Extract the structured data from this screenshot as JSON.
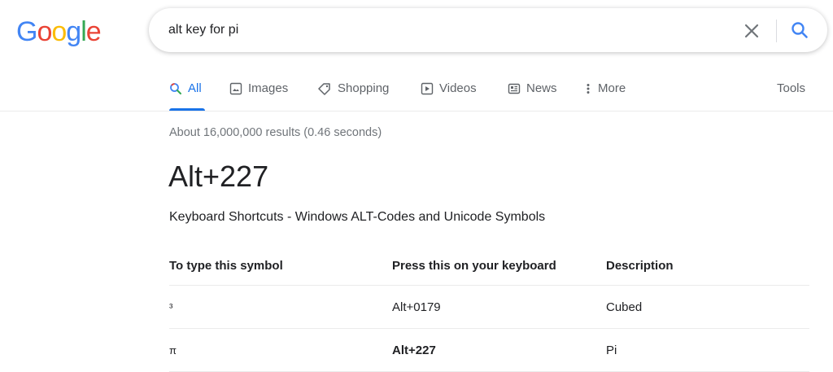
{
  "logo": {
    "letters": [
      "G",
      "o",
      "o",
      "g",
      "l",
      "e"
    ],
    "colors": [
      "#4285F4",
      "#EA4335",
      "#FBBC05",
      "#4285F4",
      "#34A853",
      "#EA4335"
    ]
  },
  "search": {
    "query": "alt key for pi",
    "clear_icon": "close-icon",
    "search_icon": "search-icon"
  },
  "tabs": [
    {
      "label": "All",
      "icon": "search-icon",
      "active": true
    },
    {
      "label": "Images",
      "icon": "image-icon"
    },
    {
      "label": "Shopping",
      "icon": "tag-icon"
    },
    {
      "label": "Videos",
      "icon": "play-icon"
    },
    {
      "label": "News",
      "icon": "newspaper-icon"
    },
    {
      "label": "More",
      "icon": "more-vert-icon"
    }
  ],
  "tools_label": "Tools",
  "result_stats": "About 16,000,000 results (0.46 seconds)",
  "featured": {
    "answer": "Alt+227",
    "source_title": "Keyboard Shortcuts - Windows ALT-Codes and Unicode Symbols",
    "table": {
      "headers": [
        "To type this symbol",
        "Press this on your keyboard",
        "Description"
      ],
      "rows": [
        [
          "³",
          "Alt+0179",
          "Cubed"
        ],
        [
          "π",
          "Alt+227",
          "Pi"
        ]
      ]
    }
  },
  "colors": {
    "accent": "#1a73e8",
    "muted": "#5f6368"
  }
}
